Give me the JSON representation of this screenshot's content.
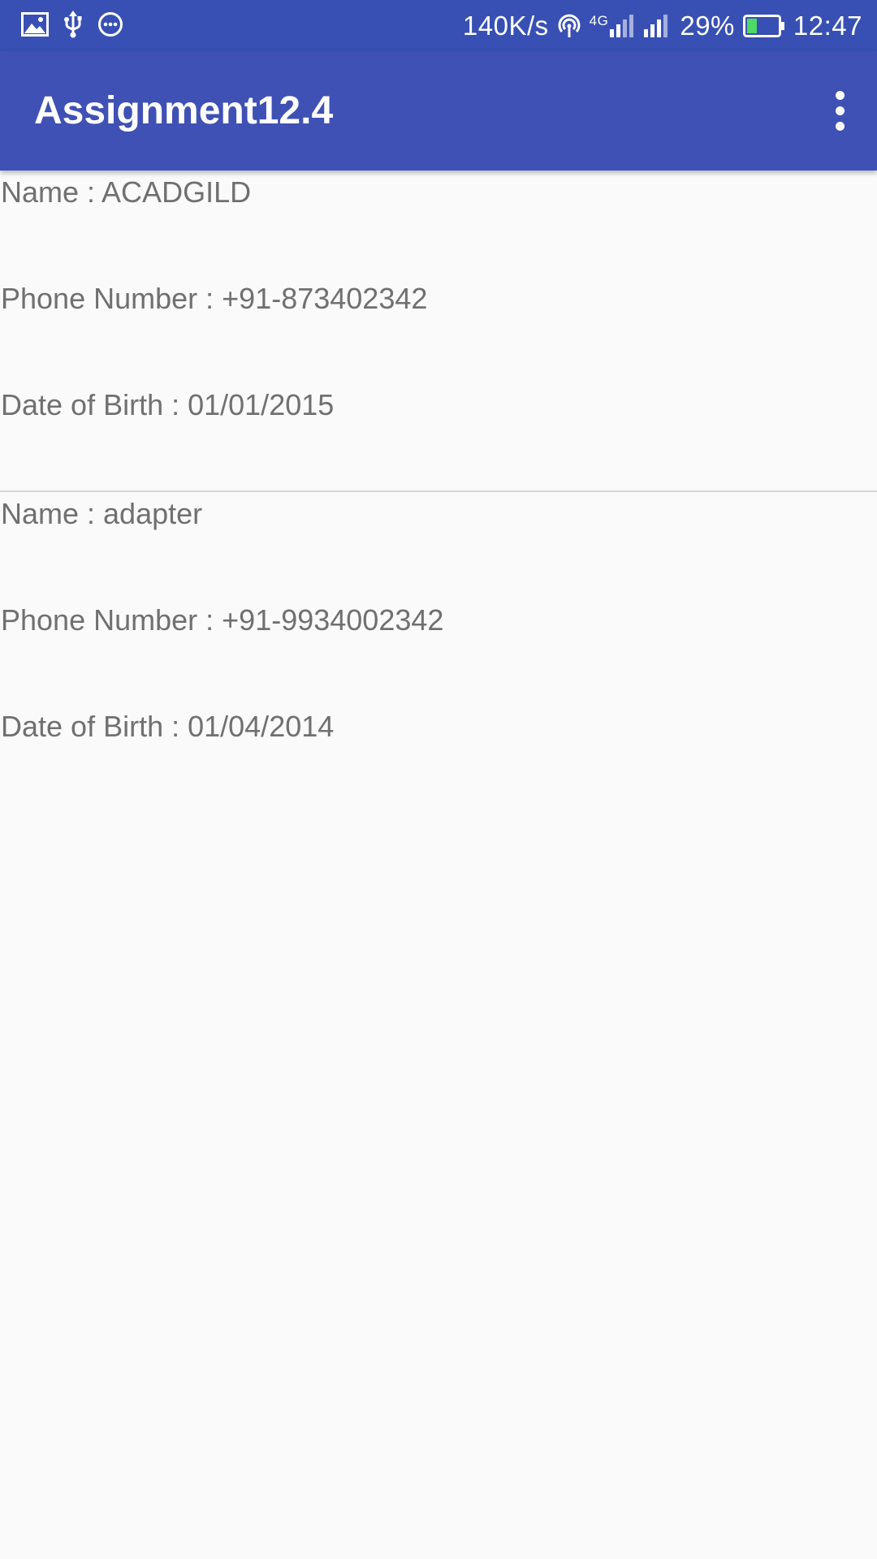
{
  "status_bar": {
    "network_speed": "140K/s",
    "network_type": "4G",
    "battery": "29%",
    "time": "12:47",
    "icons": [
      "image-icon",
      "usb-icon",
      "more-notifications-icon",
      "hotspot-icon",
      "signal-4g-icon",
      "signal-icon",
      "battery-icon"
    ],
    "background": "#3850b4",
    "battery_fill_color": "#4cd964"
  },
  "app_bar": {
    "title": "Assignment12.4",
    "background": "#3f51b5",
    "overflow_icon": "more-vert-icon"
  },
  "contacts": [
    {
      "name_line": "Name : ACADGILD",
      "phone_line": "Phone Number : +91-873402342",
      "dob_line": "Date of Birth : 01/01/2015"
    },
    {
      "name_line": "Name : adapter",
      "phone_line": "Phone Number : +91-9934002342",
      "dob_line": "Date of Birth : 01/04/2014"
    }
  ]
}
